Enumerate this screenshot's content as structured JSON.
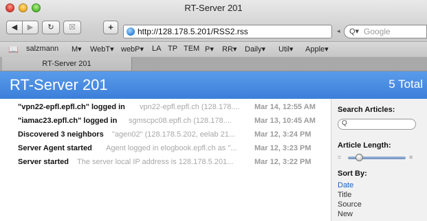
{
  "window": {
    "title": "RT-Server 201"
  },
  "toolbar": {
    "back_icon": "◀",
    "forward_icon": "▶",
    "reload_icon": "↻",
    "snapback_icon": "☒",
    "add_bookmark_icon": "+",
    "address_url": "http://128.178.5.201/RSS2.rss",
    "search_placeholder": "Google",
    "search_icon": "Q▾"
  },
  "bookmarks": [
    "salzmann",
    "M▾",
    "WebT▾",
    "webP▾",
    "LA",
    "TP",
    "TEM",
    "P▾",
    "RR▾",
    "Daily▾",
    "Util▾",
    "Apple▾"
  ],
  "tabs": [
    {
      "label": "RT-Server 201"
    }
  ],
  "header": {
    "title": "RT-Server 201",
    "total": "5 Total"
  },
  "articles": [
    {
      "title": "\"vpn22-epfl.epfl.ch\" logged in",
      "snippet": "vpn22-epfl.epfl.ch (128.178....",
      "date": "Mar 14, 12:55 AM"
    },
    {
      "title": "\"iamac23.epfl.ch\" logged in",
      "snippet": "sgmscpc08.epfl.ch (128.178....",
      "date": "Mar 13, 10:45 AM"
    },
    {
      "title": "Discovered 3 neighbors",
      "snippet": "\"agen02\" (128.178.5.202, eelab 21...",
      "date": "Mar 12, 3:24 PM"
    },
    {
      "title": "Server Agent started",
      "snippet": "Agent logged in elogbook.epfl.ch as \"...",
      "date": "Mar 12, 3:23 PM"
    },
    {
      "title": "Server started",
      "snippet": "The server local IP address is 128.178.5.201...",
      "date": "Mar 12, 3:22 PM"
    }
  ],
  "sidebar": {
    "search_label": "Search Articles:",
    "search_icon": "Q",
    "length_label": "Article Length:",
    "length_level": 0.2,
    "sort_label": "Sort By:",
    "sort_options": [
      "Date",
      "Title",
      "Source",
      "New"
    ],
    "sort_selected": "Date"
  },
  "colors": {
    "header_blue": "#4a8ee2",
    "sort_active": "#1a5fc8"
  }
}
